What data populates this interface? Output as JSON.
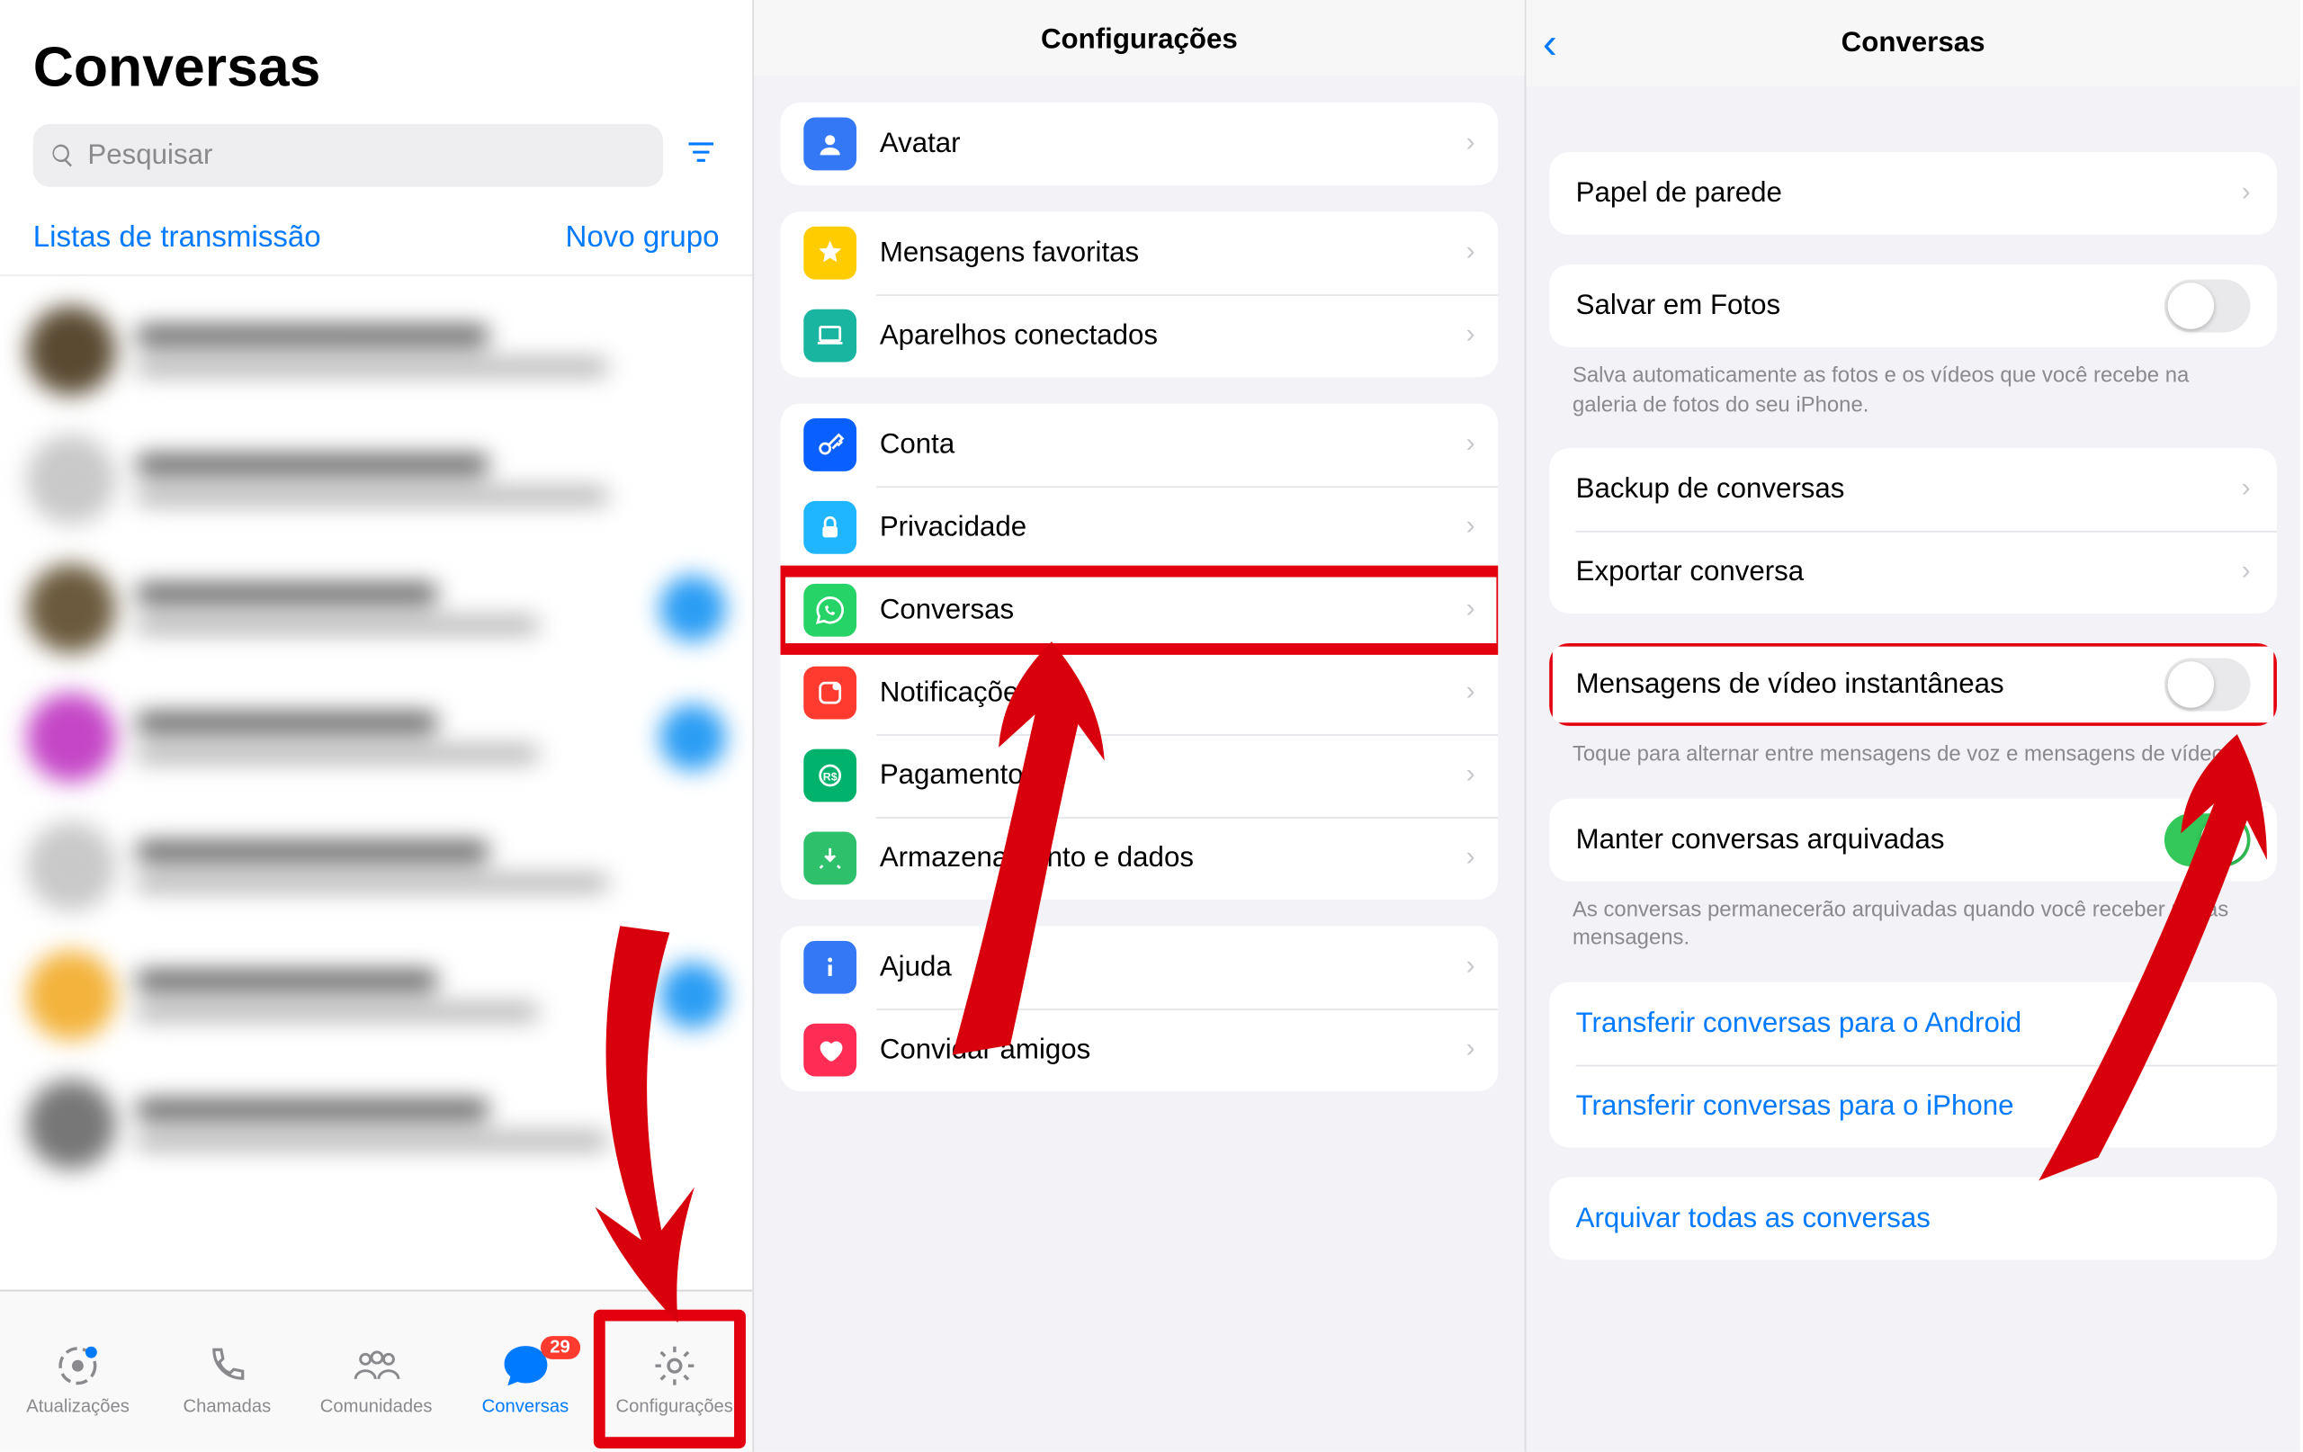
{
  "panel1": {
    "title": "Conversas",
    "search_placeholder": "Pesquisar",
    "link_left": "Listas de transmissão",
    "link_right": "Novo grupo",
    "tabs": {
      "updates": "Atualizações",
      "calls": "Chamadas",
      "communities": "Comunidades",
      "chats": "Conversas",
      "settings": "Configurações",
      "chats_badge": "29"
    }
  },
  "panel2": {
    "title": "Configurações",
    "items": {
      "avatar": "Avatar",
      "fav": "Mensagens favoritas",
      "linked": "Aparelhos conectados",
      "account": "Conta",
      "privacy": "Privacidade",
      "chats": "Conversas",
      "notif": "Notificações",
      "payments": "Pagamentos",
      "storage": "Armazenamento e dados",
      "help": "Ajuda",
      "invite": "Convidar amigos"
    }
  },
  "panel3": {
    "title": "Conversas",
    "wallpaper": "Papel de parede",
    "save_photos": "Salvar em Fotos",
    "save_photos_note": "Salva automaticamente as fotos e os vídeos que você recebe na galeria de fotos do seu iPhone.",
    "backup": "Backup de conversas",
    "export": "Exportar conversa",
    "instant_video": "Mensagens de vídeo instantâneas",
    "instant_video_note": "Toque para alternar entre mensagens de voz e mensagens de vídeo.",
    "keep_archived": "Manter conversas arquivadas",
    "keep_archived_note": "As conversas permanecerão arquivadas quando você receber novas mensagens.",
    "transfer_android": "Transferir conversas para o Android",
    "transfer_iphone": "Transferir conversas para o iPhone",
    "archive_all": "Arquivar todas as conversas"
  },
  "chat_data": null
}
